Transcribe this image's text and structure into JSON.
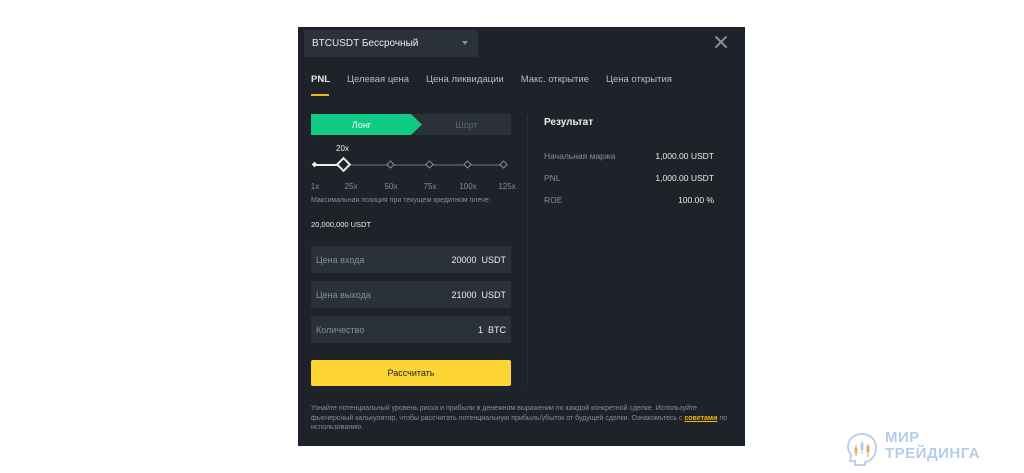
{
  "header": {
    "pair": "BTCUSDT Бессрочный"
  },
  "tabs": [
    "PNL",
    "Целевая цена",
    "Цена ликвидации",
    "Макс. открытие",
    "Цена открытия"
  ],
  "side": {
    "long": "Лонг",
    "short": "Шорт",
    "selected": "long"
  },
  "leverage": {
    "current": "20x",
    "ticks": [
      "1x",
      "25x",
      "50x",
      "75x",
      "100x",
      "125x"
    ],
    "max_position_label": "Максимальная позиция при текущем кредитном плече:",
    "max_position_value": "20,000,000 USDT"
  },
  "fields": {
    "entry": {
      "label": "Цена входа",
      "value": "20000",
      "unit": "USDT"
    },
    "exit": {
      "label": "Цена выхода",
      "value": "21000",
      "unit": "USDT"
    },
    "qty": {
      "label": "Количество",
      "value": "1",
      "unit": "BTC"
    }
  },
  "calculate_label": "Рассчитать",
  "result": {
    "title": "Результат",
    "rows": [
      {
        "label": "Начальная маржа",
        "value": "1,000.00 USDT"
      },
      {
        "label": "PNL",
        "value": "1,000.00 USDT"
      },
      {
        "label": "ROE",
        "value": "100.00 %"
      }
    ]
  },
  "footer": {
    "text_before": "Узнайте потенциальный уровень риска и прибыли в денежном выражении по каждой конкретной сделке. Используйте фьючерсный калькулятор, чтобы рассчитать потенциальную прибыль/убыток от будущей сделки. Ознакомьтесь с ",
    "link": "советами",
    "text_after": " по использованию."
  },
  "watermark": {
    "line1": "МИР",
    "line2": "ТРЕЙДИНГА"
  },
  "colors": {
    "accent": "#fcd535",
    "long": "#0ecb81",
    "background": "#1e2329"
  }
}
